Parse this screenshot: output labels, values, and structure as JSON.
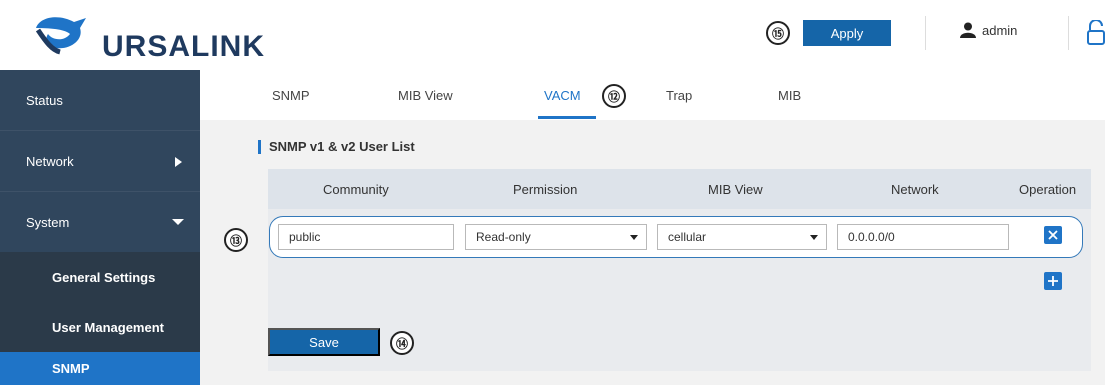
{
  "app": {
    "brand": "URSALINK"
  },
  "header": {
    "apply_label": "Apply",
    "apply_callout": "⑮",
    "user": "admin"
  },
  "sidebar": {
    "items": [
      {
        "label": "Status"
      },
      {
        "label": "Network"
      },
      {
        "label": "System"
      },
      {
        "label": "General Settings"
      },
      {
        "label": "User Management"
      },
      {
        "label": "SNMP"
      }
    ]
  },
  "tabs": {
    "items": [
      {
        "label": "SNMP"
      },
      {
        "label": "MIB View"
      },
      {
        "label": "VACM"
      },
      {
        "label": "Trap"
      },
      {
        "label": "MIB"
      }
    ],
    "active_callout": "⑫"
  },
  "section": {
    "title": "SNMP v1 & v2 User List"
  },
  "table": {
    "columns": [
      "Community",
      "Permission",
      "MIB View",
      "Network",
      "Operation"
    ],
    "row_callout": "⑬",
    "rows": [
      {
        "community": "public",
        "permission": "Read-only",
        "mib_view": "cellular",
        "network": "0.0.0.0/0"
      }
    ]
  },
  "actions": {
    "save_label": "Save",
    "save_callout": "⑭"
  },
  "colors": {
    "primary": "#1f74c7",
    "sidebar_bg": "#2f3c4a",
    "button_bg": "#1565a8"
  }
}
